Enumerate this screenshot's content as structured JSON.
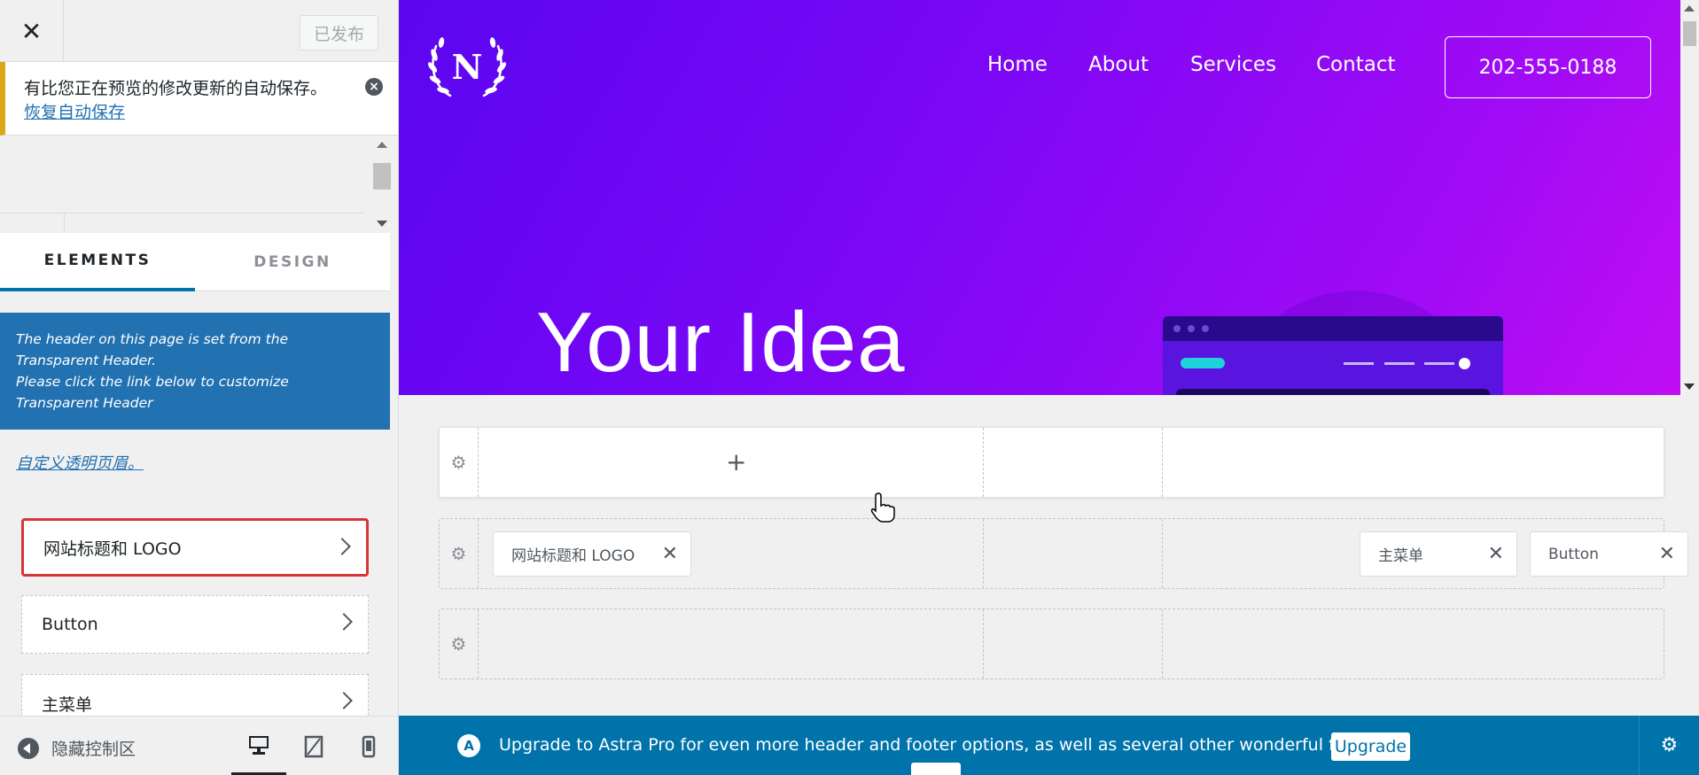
{
  "left": {
    "close_icon": "✕",
    "publish_label": "已发布",
    "notice": {
      "message": "有比您正在预览的修改更新的自动保存。",
      "link": "恢复自动保存"
    },
    "tabs": [
      {
        "label": "ELEMENTS"
      },
      {
        "label": "DESIGN"
      }
    ],
    "info_line1": "The header on this page is set from the Transparent Header.",
    "info_line2": "Please click the link below to customize Transparent Header",
    "custom_link": "自定义透明页眉。",
    "items": [
      {
        "label": "网站标题和 LOGO"
      },
      {
        "label": "Button"
      },
      {
        "label": "主菜单"
      }
    ],
    "footer": {
      "hide_controls": "隐藏控制区"
    }
  },
  "preview": {
    "logo_letter": "N",
    "nav": [
      "Home",
      "About",
      "Services",
      "Contact"
    ],
    "phone": "202-555-0188",
    "hero_title": "Your Idea",
    "colors": {
      "gradient_start": "#5b06f0",
      "gradient_end": "#c00ef3",
      "accent_teal": "#1fd3d8"
    }
  },
  "builder": {
    "plus": "+",
    "chips": {
      "site_logo": "网站标题和 LOGO",
      "main_menu": "主菜单",
      "button": "Button"
    },
    "remove_glyph": "✕"
  },
  "astra_bar": {
    "logo_glyph": "A",
    "message": "Upgrade to Astra Pro for even more header and footer options, as well as several other wonderful features!",
    "upgrade_label": "Upgrade",
    "color": "#0073aa"
  }
}
